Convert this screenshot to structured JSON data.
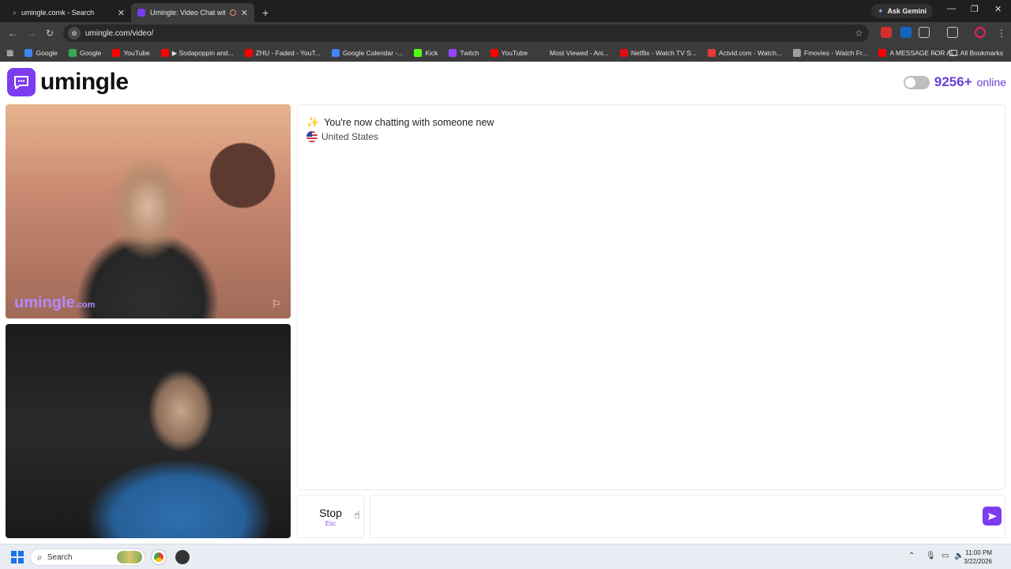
{
  "browser": {
    "tabs": [
      {
        "title": "umingle.comk - Search",
        "active": false
      },
      {
        "title": "Umingle: Video Chat with S",
        "active": true
      }
    ],
    "new_tab_symbol": "+",
    "gemini_label": "Ask Gemini",
    "url": "umingle.com/video/",
    "bookmarks": [
      {
        "label": "Google",
        "icon": "google-icon",
        "color": "#4285f4"
      },
      {
        "label": "Google",
        "icon": "google-icon",
        "color": "#34a853"
      },
      {
        "label": "YouTube",
        "icon": "youtube-icon",
        "color": "#ff0000"
      },
      {
        "label": "▶ Sodapoppin and...",
        "icon": "youtube-icon",
        "color": "#ff0000"
      },
      {
        "label": "ZHU - Faded - YouT...",
        "icon": "youtube-icon",
        "color": "#ff0000"
      },
      {
        "label": "Google Calendar -...",
        "icon": "calendar-icon",
        "color": "#4285f4"
      },
      {
        "label": "Kick",
        "icon": "kick-icon",
        "color": "#53fc18"
      },
      {
        "label": "Twitch",
        "icon": "twitch-icon",
        "color": "#9146ff"
      },
      {
        "label": "YouTube",
        "icon": "youtube-icon",
        "color": "#ff0000"
      },
      {
        "label": "Most Viewed - Ani...",
        "icon": "page-icon",
        "color": "#3c3c3c"
      },
      {
        "label": "Netflix - Watch TV S...",
        "icon": "netflix-icon",
        "color": "#e50914"
      },
      {
        "label": "Actvid.com - Watch...",
        "icon": "actvid-icon",
        "color": "#e53935"
      },
      {
        "label": "Fmovies - Watch Fr...",
        "icon": "globe-icon",
        "color": "#9e9e9e"
      },
      {
        "label": "A MESSAGE FOR AL...",
        "icon": "youtube-icon",
        "color": "#ff0000"
      }
    ],
    "all_bookmarks_label": "All Bookmarks"
  },
  "site": {
    "logo_text": "umingle",
    "accent_color": "#7d3cf0",
    "online_count": "9256+",
    "online_label": "online"
  },
  "videos": {
    "stranger_watermark": "umingle",
    "stranger_watermark_domain": ".com"
  },
  "chat": {
    "system_message": "You're now chatting with someone new",
    "country": "United States",
    "stop_label": "Stop",
    "stop_key": "Esc",
    "input_value": ""
  },
  "taskbar": {
    "search_label": "Search",
    "time": "11:00 PM",
    "date": "3/22/2026"
  }
}
